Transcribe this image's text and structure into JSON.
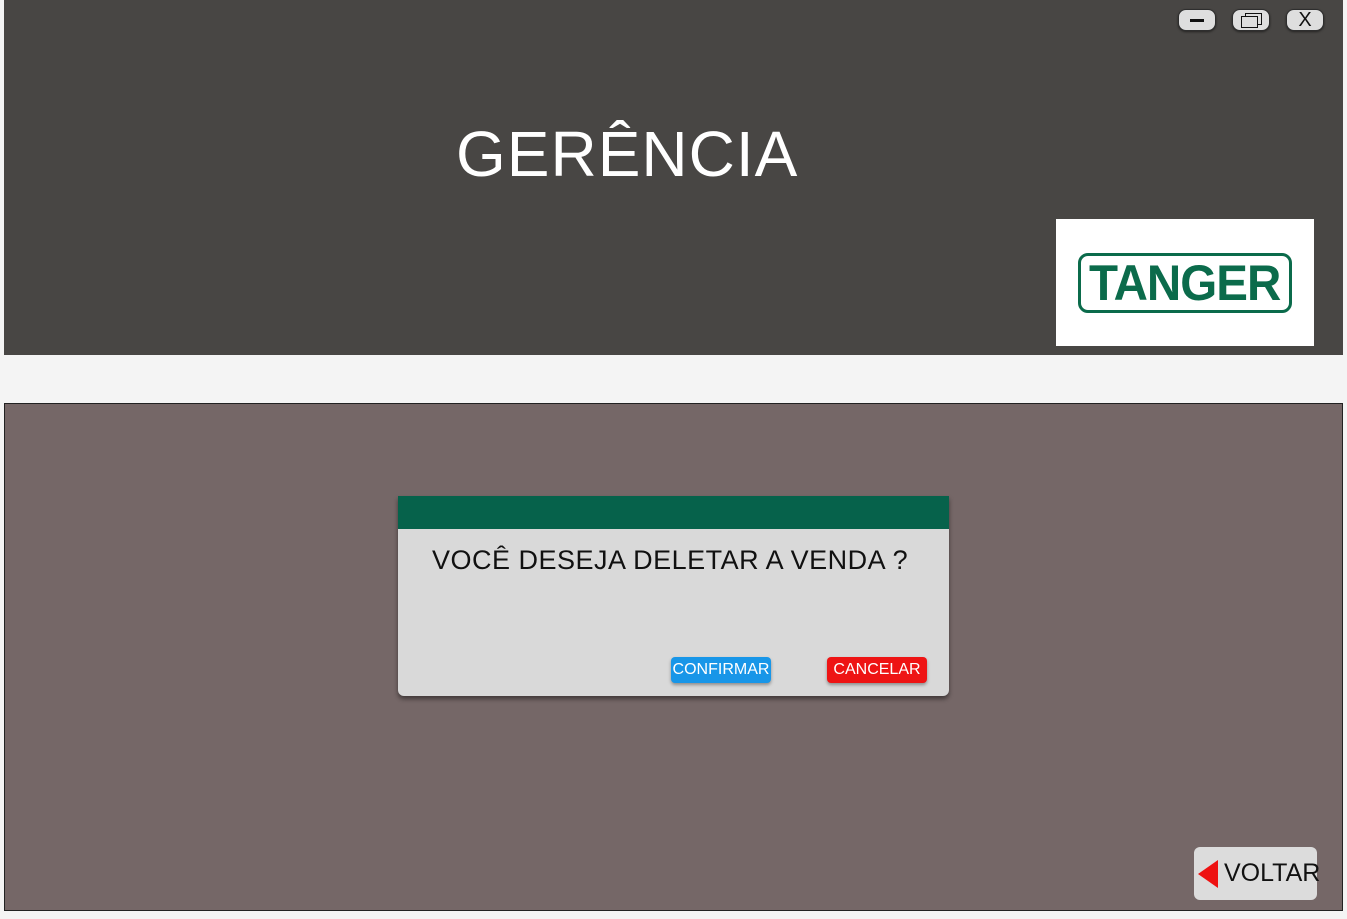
{
  "window": {
    "minimize_icon": "minimize-icon",
    "maximize_icon": "maximize-icon",
    "close_label": "X"
  },
  "header": {
    "title": "GERÊNCIA",
    "logo_text": "TANGER",
    "logo_color": "#0b6b4b",
    "background": "#484644"
  },
  "dialog": {
    "header_color": "#06624b",
    "message": "VOCÊ DESEJA DELETAR A VENDA ?",
    "confirm_label": "CONFIRMAR",
    "confirm_color": "#1896e8",
    "cancel_label": "CANCELAR",
    "cancel_color": "#ee1414"
  },
  "footer": {
    "back_label": "VOLTAR",
    "back_icon": "left-arrow-icon"
  }
}
